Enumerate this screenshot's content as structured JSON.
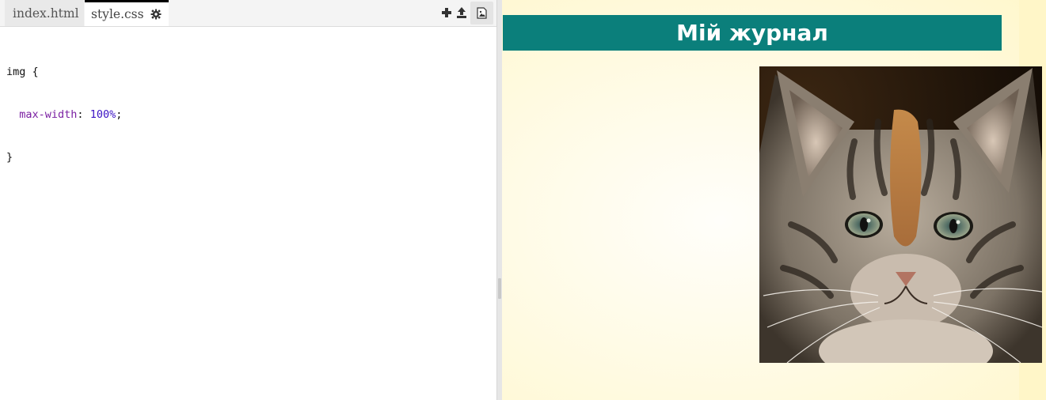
{
  "editor": {
    "tabs": [
      {
        "label": "index.html",
        "active": false
      },
      {
        "label": "style.css",
        "active": true
      }
    ],
    "icons": [
      "gear-icon",
      "plus-icon",
      "upload-icon",
      "image-icon"
    ],
    "code": {
      "line1": "img {",
      "line2_prop": "max-width",
      "line2_colon": ": ",
      "line2_value": "100%",
      "line2_semicolon": ";",
      "line3": "}"
    }
  },
  "preview": {
    "banner_title": "Мій журнал",
    "image_alt": "kitten-photo"
  },
  "colors": {
    "banner": "#0b7f7b",
    "preview_background": "#fffbe6",
    "css_property": "#7a1fa2",
    "css_value": "#3a12c4"
  }
}
